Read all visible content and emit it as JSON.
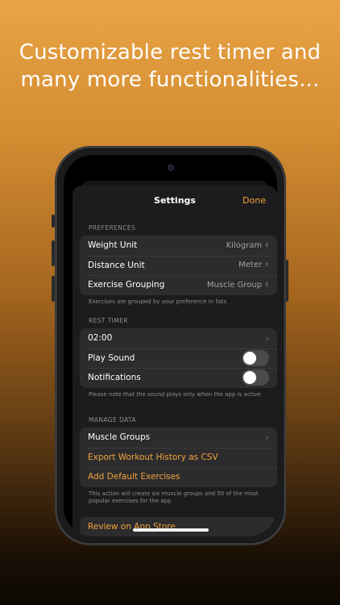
{
  "headline": {
    "line1": "Customizable rest timer and",
    "line2": "many more functionalities..."
  },
  "nav": {
    "title": "Settings",
    "done": "Done"
  },
  "preferences": {
    "header": "PREFERENCES",
    "rows": [
      {
        "label": "Weight Unit",
        "value": "Kilogram"
      },
      {
        "label": "Distance Unit",
        "value": "Meter"
      },
      {
        "label": "Exercise Grouping",
        "value": "Muscle Group"
      }
    ],
    "footnote": "Exercises are grouped by your preference in lists"
  },
  "rest_timer": {
    "header": "REST TIMER",
    "duration": "02:00",
    "play_sound_label": "Play Sound",
    "play_sound_on": false,
    "notifications_label": "Notifications",
    "notifications_on": false,
    "footnote": "Please note that the sound plays only when the app is active"
  },
  "manage_data": {
    "header": "MANAGE DATA",
    "muscle_groups": "Muscle Groups",
    "export": "Export Workout History as CSV",
    "add_defaults": "Add Default Exercises",
    "footnote": "This action will create six muscle groups and 50 of the most popular exercises for the app"
  },
  "review": {
    "label": "Review on App Store"
  },
  "colors": {
    "accent": "#f2a33a",
    "group_bg": "#2c2c2e",
    "sheet_bg": "#1c1c1e"
  },
  "icons": {
    "updown": "chevron-up-down-icon",
    "disclosure": "chevron-right-icon"
  }
}
